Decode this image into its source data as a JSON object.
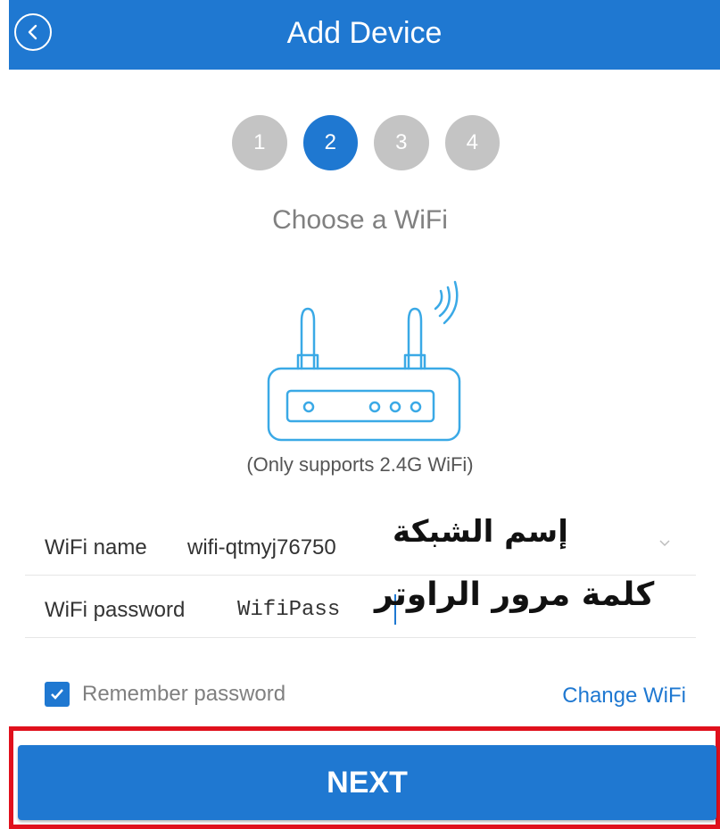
{
  "header": {
    "title": "Add Device",
    "back_icon": "back-chevron-icon"
  },
  "steps": [
    {
      "label": "1",
      "active": false
    },
    {
      "label": "2",
      "active": true
    },
    {
      "label": "3",
      "active": false
    },
    {
      "label": "4",
      "active": false
    }
  ],
  "subtitle": "Choose a WiFi",
  "note": "(Only supports 2.4G WiFi)",
  "fields": {
    "wifi_name": {
      "label": "WiFi name",
      "value": "wifi-qtmyj76750"
    },
    "wifi_password": {
      "label": "WiFi password",
      "value": "WifiPass"
    }
  },
  "annotations": {
    "network_name": "إسم الشبكة",
    "router_password": "كلمة مرور الراوتر"
  },
  "remember": {
    "label": "Remember password",
    "checked": true
  },
  "change_wifi": "Change WiFi",
  "next_label": "NEXT",
  "colors": {
    "primary": "#1f78d1",
    "inactive_step": "#c4c4c4",
    "highlight": "#e0101c"
  }
}
